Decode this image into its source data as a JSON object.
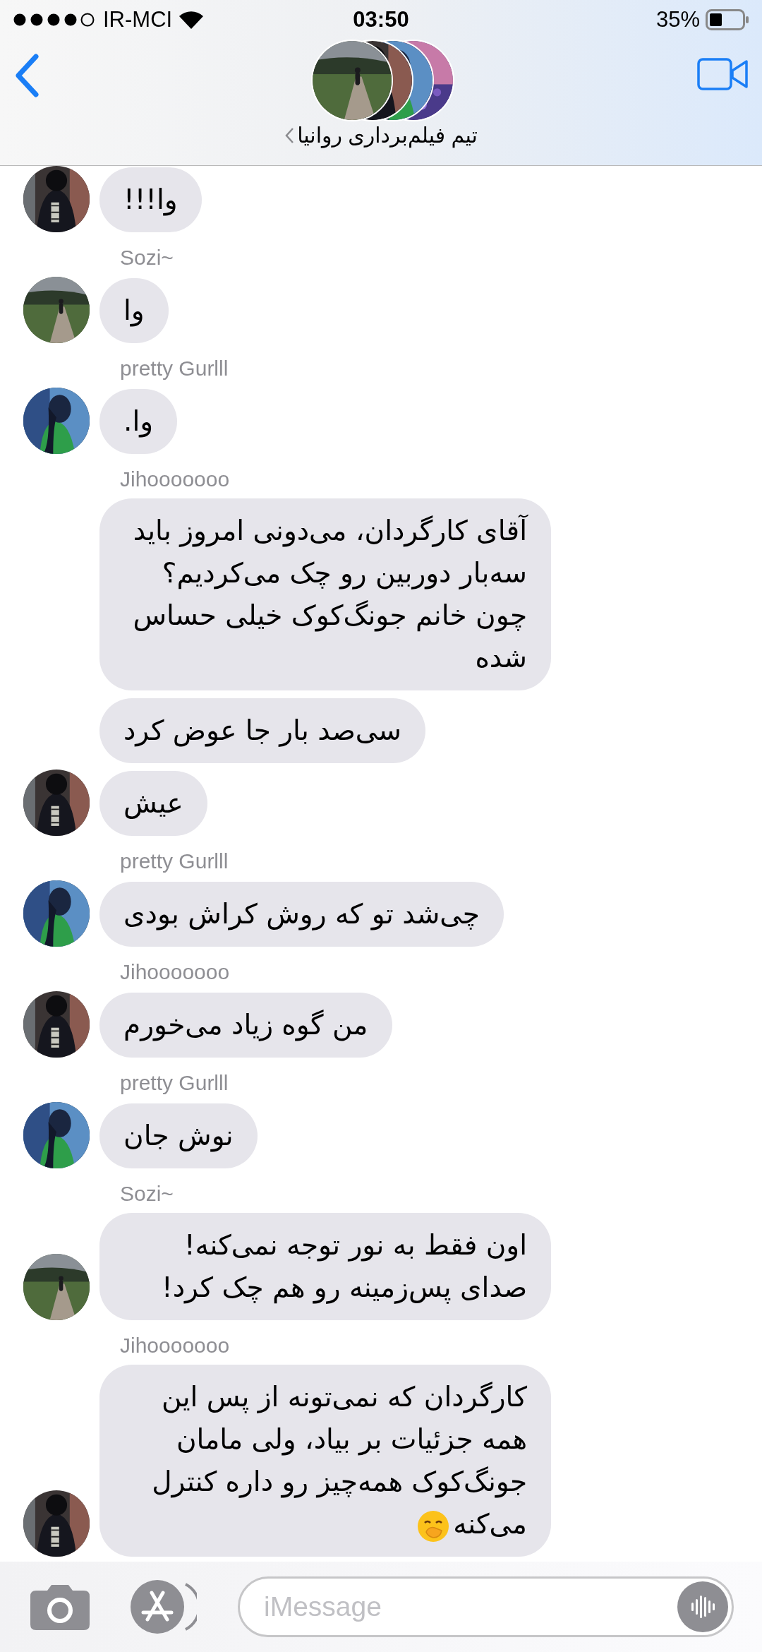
{
  "status_bar": {
    "carrier": "IR-MCI",
    "time": "03:50",
    "battery": "35%"
  },
  "header": {
    "title": "تیم فیلم‌برداری روانیا"
  },
  "groups": [
    {
      "messages": [
        {
          "text": "وا!!!"
        }
      ]
    },
    {
      "sender": "Sozi~",
      "messages": [
        {
          "text": "وا"
        }
      ]
    },
    {
      "sender": "pretty Gurlll",
      "messages": [
        {
          "text": "وا."
        }
      ]
    },
    {
      "sender": "Jihooooooo",
      "messages": [
        {
          "text": "آقای کارگردان، می‌دونی امروز باید سه‌بار دوربین رو چک می‌کردیم؟ چون خانم جونگ‌کوک خیلی حساس شده"
        },
        {
          "text": "سی‌صد بار جا عوض کرد"
        },
        {
          "text": "عیش"
        }
      ]
    },
    {
      "sender": "pretty Gurlll",
      "messages": [
        {
          "text": "چی‌شد تو که روش کراش بودی"
        }
      ]
    },
    {
      "sender": "Jihooooooo",
      "messages": [
        {
          "text": "من گوه زیاد می‌خورم"
        }
      ]
    },
    {
      "sender": "pretty Gurlll",
      "messages": [
        {
          "text": "نوش جان"
        }
      ]
    },
    {
      "sender": "Sozi~",
      "messages": [
        {
          "text": "اون فقط به نور توجه نمی‌کنه! صدای پس‌زمینه رو هم چک کرد!"
        }
      ]
    },
    {
      "sender": "Jihooooooo",
      "messages": [
        {
          "text": "کارگردان که نمی‌تونه از پس این همه جزئیات بر بیاد، ولی مامان جونگ‌کوک همه‌چیز رو داره کنترل می‌کنه",
          "emoji": true
        }
      ]
    }
  ],
  "composer": {
    "placeholder": "iMessage"
  }
}
